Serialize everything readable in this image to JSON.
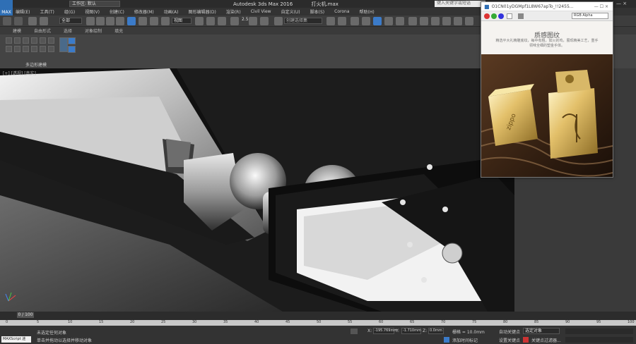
{
  "app": {
    "title": "Autodesk 3ds Max 2016",
    "file": "打火机.max",
    "logo": "MAX",
    "workspace": "工作区: 默认",
    "search_placeholder": "键入关键字或短语"
  },
  "menu": [
    "编辑(E)",
    "工具(T)",
    "组(G)",
    "视图(V)",
    "创建(C)",
    "修改器(M)",
    "动画(A)",
    "图形编辑器(D)",
    "渲染(R)",
    "Civil View",
    "自定义(U)",
    "脚本(S)",
    "Corona",
    "帮助(H)"
  ],
  "toolbar": {
    "filter": "全部",
    "view": "视图",
    "count": "2.5",
    "named_selection": "创建选择集"
  },
  "ribbon": {
    "tabs": [
      "建模",
      "自由形式",
      "选择",
      "对象绘制",
      "填充"
    ],
    "group_label": "多边形建模"
  },
  "viewport": {
    "label": "[+] [透视] [真实]"
  },
  "timeline": {
    "frame": "0 / 100",
    "ticks": [
      "0",
      "5",
      "10",
      "15",
      "20",
      "25",
      "30",
      "35",
      "40",
      "45",
      "50",
      "55",
      "60",
      "65",
      "70",
      "75",
      "80",
      "85",
      "90",
      "95",
      "100"
    ]
  },
  "status": {
    "script": "MAXScript 迷",
    "msg1": "未选定任何对象",
    "msg2": "单击并拖动以选择并移动对象",
    "x": "-195.769mm",
    "y": "-1.710mm",
    "z": "0.0mm",
    "grid": "栅格 = 10.0mm",
    "auto_key": "自动关键点",
    "selected": "选定对象",
    "set_key": "设置关键点",
    "key_filter": "关键点过滤器...",
    "add_time_tag": "添加时间标记"
  },
  "float_window": {
    "title": "O1CN01yDGMpf1L8W67apTo_!!2455...",
    "channel": "RGB Alpha",
    "heading": "质感图纹",
    "subtitle": "精选平大礼精雕底纹，每中有粗，如火的鸡，展现精美工艺，重手领味全细的塑金手体。",
    "photo_text": "zippo",
    "colors": {
      "accent": "#2f6fb5",
      "bg": "#f5f3f0"
    }
  }
}
